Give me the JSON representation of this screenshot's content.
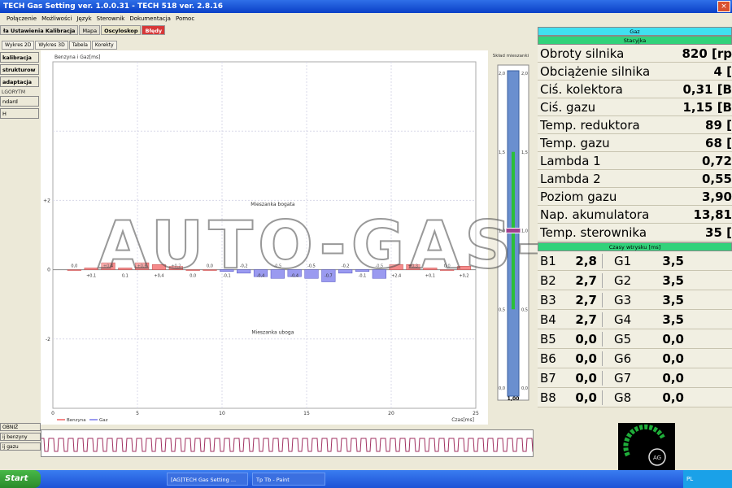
{
  "window": {
    "title": "TECH Gas Setting  ver. 1.0.0.31   -   TECH 518  ver. 2.8.16",
    "close": "×"
  },
  "menu": [
    "Połączenie",
    "Możliwości",
    "Język",
    "Sterownik",
    "Dokumentacja",
    "Pomoc"
  ],
  "tabs": {
    "main": "ła Ustawienia Kalibracja",
    "mapa": "Mapa",
    "oscy": "Oscyloskop",
    "errors": "Błędy"
  },
  "subtabs": [
    "Wykres 2D",
    "Wykres 3D",
    "Tabela",
    "Korekty"
  ],
  "left": {
    "buttons": [
      "kalibracja",
      "strukturow",
      "adaptacja"
    ],
    "section_label": "LGORYTM",
    "options": [
      "ndard",
      "H"
    ],
    "bottom": [
      "OBNIŻ",
      "ij benzyny",
      "ij gazu"
    ]
  },
  "chart_data": {
    "type": "bar",
    "title": "Benzyna i Gaz[ms]",
    "xlabel": "Czas[ms]",
    "ylabel": "",
    "xlim": [
      0,
      25
    ],
    "ylim": [
      -4,
      6
    ],
    "x_ticks": [
      "0",
      "5",
      "10",
      "15",
      "20",
      "25"
    ],
    "y_ticks": [
      "+2",
      "0",
      "-2"
    ],
    "annotations": {
      "rich": "Mieszanka bogata",
      "lean": "Mieszanka uboga"
    },
    "legend": [
      "Benzyna",
      "Gaz"
    ],
    "colors": {
      "benzyna": "#f58a8a",
      "gaz": "#9a9af0"
    },
    "grid": true,
    "series": [
      {
        "name": "Benzyna",
        "values": [
          0.4,
          0.9,
          0.9,
          0.9,
          0.9,
          0.3,
          0.9,
          0.9,
          0.9,
          0.9,
          0.9,
          0.8,
          0.9,
          0.9,
          0.9,
          0.9,
          0.9,
          0.9,
          0.9,
          0.7,
          0.9,
          0.6,
          0.5,
          0.9,
          0.6,
          0.4,
          0.5,
          0.4
        ]
      },
      {
        "name": "Gaz",
        "values": [
          0.6,
          0.9,
          0.9,
          0.9,
          0.5,
          0.5,
          0.9,
          0.9,
          0.9,
          0.9,
          0.8,
          0.9,
          0.9,
          0.9,
          0.9,
          0.9,
          0.9,
          0.9,
          0.9,
          0.9,
          0.9,
          0.6,
          0.6,
          0.9,
          0.6,
          0.8,
          0.6,
          0.4
        ]
      }
    ],
    "corrections": [
      0.0,
      0.1,
      0.4,
      0.1,
      0.4,
      0.3,
      0.2,
      0.0,
      0.0,
      -0.1,
      -0.2,
      -0.4,
      -0.5,
      -0.4,
      -0.5,
      -0.7,
      -0.2,
      -0.1,
      -0.5,
      0.3,
      0.3,
      0.1,
      0.0,
      0.2
    ],
    "correction_labels": [
      "0,0",
      "+0,1",
      "+0,4",
      "0,1",
      "+0,6",
      "+0,4",
      "+0,2",
      "0,0",
      "0,0",
      "-0,1",
      "-0,2",
      "-0,4",
      "-0,5",
      "-0,4",
      "-0,5",
      "-0,7",
      "-0,2",
      "-0,1",
      "-0,5",
      "+2,4",
      "+0,3",
      "+0,1",
      "0,0",
      "+0,2"
    ]
  },
  "mix": {
    "title": "Skład mieszanki",
    "ticks": [
      "2,0",
      "1,5",
      "1,0",
      "0,5",
      "0,0"
    ],
    "value": "1,00",
    "level": 1.0
  },
  "watermark": "AUTO-GAS-DC",
  "right": {
    "header_gas": "Gaz",
    "header_state": "Stacyjka",
    "params": [
      {
        "label": "Obroty silnika",
        "value": "820 [rp"
      },
      {
        "label": "Obciążenie silnika",
        "value": "4 ["
      },
      {
        "label": "Ciś. kolektora",
        "value": "0,31 [B"
      },
      {
        "label": "Ciś. gazu",
        "value": "1,15 [B"
      },
      {
        "label": "Temp. reduktora",
        "value": "89 ["
      },
      {
        "label": "Temp. gazu",
        "value": "68 ["
      },
      {
        "label": "Lambda 1",
        "value": "0,72"
      },
      {
        "label": "Lambda 2",
        "value": "0,55"
      },
      {
        "label": "Poziom gazu",
        "value": "3,90"
      },
      {
        "label": "Nap. akumulatora",
        "value": "13,81"
      },
      {
        "label": "Temp. sterownika",
        "value": "35 ["
      }
    ],
    "injectors_header": "Czasy wtrysku [ms]",
    "injectors": [
      {
        "b": "B1",
        "bv": "2,8",
        "g": "G1",
        "gv": "3,5"
      },
      {
        "b": "B2",
        "bv": "2,7",
        "g": "G2",
        "gv": "3,5"
      },
      {
        "b": "B3",
        "bv": "2,7",
        "g": "G3",
        "gv": "3,5"
      },
      {
        "b": "B4",
        "bv": "2,7",
        "g": "G4",
        "gv": "3,5"
      },
      {
        "b": "B5",
        "bv": "0,0",
        "g": "G5",
        "gv": "0,0"
      },
      {
        "b": "B6",
        "bv": "0,0",
        "g": "G6",
        "gv": "0,0"
      },
      {
        "b": "B7",
        "bv": "0,0",
        "g": "G7",
        "gv": "0,0"
      },
      {
        "b": "B8",
        "bv": "0,0",
        "g": "G8",
        "gv": "0,0"
      }
    ]
  },
  "logo": {
    "text": "AG"
  },
  "taskbar": {
    "start": "Start",
    "tasks": [
      "[AG]TECH Gas Setting ...",
      "Tp Tb - Paint"
    ],
    "tray": "PL"
  }
}
